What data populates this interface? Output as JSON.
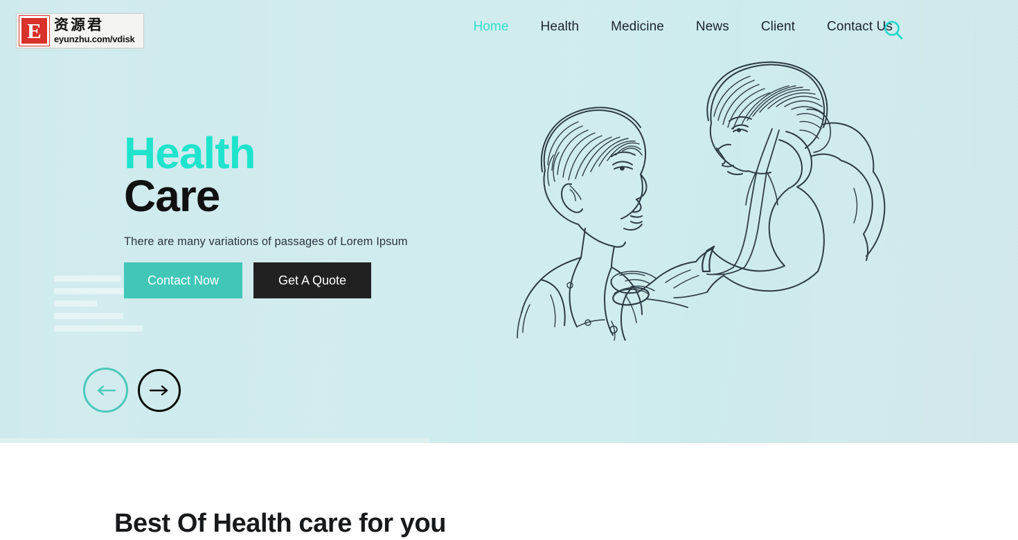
{
  "header": {
    "logo": {
      "mark_letter": "E",
      "cn_name": "资源君",
      "url": "eyunzhu.com/vdisk"
    },
    "nav_items": [
      {
        "label": "Home",
        "active": true
      },
      {
        "label": "Health",
        "active": false
      },
      {
        "label": "Medicine",
        "active": false
      },
      {
        "label": "News",
        "active": false
      },
      {
        "label": "Client",
        "active": false
      },
      {
        "label": "Contact Us",
        "active": false
      }
    ],
    "search_icon": "search-icon"
  },
  "hero": {
    "title_line1": "Health",
    "title_line2": "Care",
    "subtitle": "There are many variations of passages of Lorem Ipsum",
    "primary_button": "Contact Now",
    "secondary_button": "Get A Quote",
    "prev_arrow_glyph": "←",
    "next_arrow_glyph": "→",
    "illustration_alt": "doctor-examining-boy-with-stethoscope-line-art"
  },
  "section_below": {
    "heading": "Best Of Health care for you"
  },
  "colors": {
    "accent_teal": "#1fe3cd",
    "button_teal": "#41c6b7",
    "dark": "#212121",
    "hero_bg": "#cfeaed",
    "nav_text": "#1b2330",
    "logo_red": "#d8322a"
  }
}
